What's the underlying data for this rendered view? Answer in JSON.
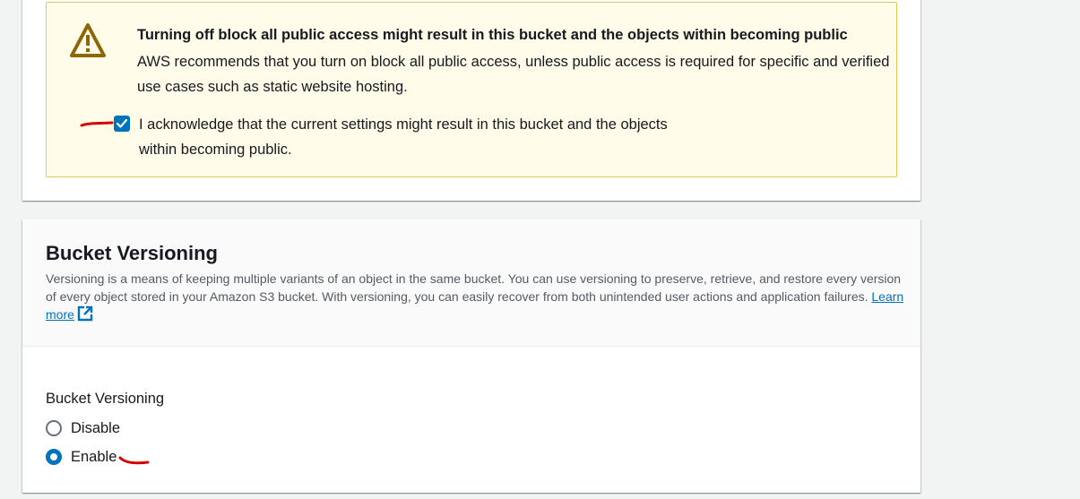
{
  "alert": {
    "icon": "warning-triangle-icon",
    "title": "Turning off block all public access might result in this bucket and the objects within becoming public",
    "body": "AWS recommends that you turn on block all public access, unless public access is required for specific and verified use cases such as static website hosting.",
    "acknowledge_label": "I acknowledge that the current settings might result in this bucket and the objects within becoming public.",
    "acknowledge_checked": true
  },
  "versioning": {
    "title": "Bucket Versioning",
    "description": "Versioning is a means of keeping multiple variants of an object in the same bucket. You can use versioning to preserve, retrieve, and restore every version of every object stored in your Amazon S3 bucket. With versioning, you can easily recover from both unintended user actions and application failures.",
    "learn_more": "Learn more",
    "field_label": "Bucket Versioning",
    "options": [
      {
        "label": "Disable",
        "selected": false
      },
      {
        "label": "Enable",
        "selected": true
      }
    ]
  },
  "colors": {
    "accent": "#0073bb",
    "warning_bg": "#fffce9",
    "warning_border": "#e0ca57",
    "annotation": "#d40000"
  }
}
